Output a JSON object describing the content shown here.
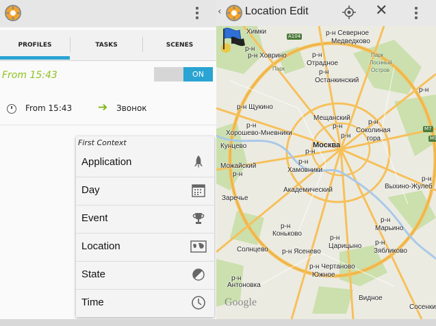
{
  "left_panel": {
    "tabs": [
      {
        "label": "PROFILES"
      },
      {
        "label": "TASKS"
      },
      {
        "label": "SCENES"
      }
    ],
    "profile": {
      "title": "From 15:43",
      "toggle_label": "ON",
      "context_text": "From 15:43",
      "task_text": "Звонок"
    },
    "context_menu": {
      "header": "First Context",
      "items": [
        {
          "label": "Application",
          "icon": "rocket-icon"
        },
        {
          "label": "Day",
          "icon": "calendar-icon"
        },
        {
          "label": "Event",
          "icon": "trophy-icon"
        },
        {
          "label": "Location",
          "icon": "map-icon"
        },
        {
          "label": "State",
          "icon": "half-circle-icon"
        },
        {
          "label": "Time",
          "icon": "clock-icon"
        }
      ]
    }
  },
  "right_panel": {
    "title": "Location Edit",
    "map": {
      "city": "Москва",
      "labels": {
        "khimki": "Химки",
        "a104": "А104",
        "rn_sev_medved_1": "р-н Северное",
        "rn_sev_medved_2": "Медведково",
        "rn1": "р-н",
        "khovrino": "р-н Ховрино",
        "otradnoe_rn": "р-н",
        "otradnoe": "Отрадное",
        "park_losiny_1": "Парк",
        "park_losiny_2": "Лосиный",
        "park_losiny_3": "Остров",
        "park": "Парк",
        "ostankinsky_rn": "р-н",
        "ostankinsky": "Останкинский",
        "rn_right": "р-н",
        "shchukino": "р-н Щукино",
        "rn_left": "р-н",
        "khoroshevo": "Хорошево-Мневники",
        "kuntsevo": "Кунцево",
        "meshchansky": "Мещанский",
        "meshchansky_rn": "р-н",
        "rn_mid": "р-н",
        "sokolinaya_rn": "р-н",
        "sokolinaya_1": "Соколиная",
        "sokolinaya_2": "гора",
        "moskva": "Москва",
        "mozhaysky": "Можайский",
        "khamovniki": "Хамовники",
        "rn_mid2": "р-н",
        "rn_mid3": "р-н",
        "vykhino": "Выхино-Жулеб",
        "rn_vykhino": "р-н",
        "zarechye": "Заречье",
        "akademichesky": "Академический",
        "rn_pech": "р-н",
        "konkovo": "Коньково",
        "konkovo_rn": "р-н",
        "tsaritsyno": "Царицыно",
        "rn_tsar": "р-н",
        "maryino": "Марьино",
        "maryino_rn": "р-н",
        "zyablikovo": "Зябликово",
        "zyablikovo_rn": "р-н",
        "solntsevo": "Солнцево",
        "yasenevo": "р-н Ясенево",
        "chertanovo": "р-н Чертаново",
        "yuzhnoe": "Южное",
        "rn_bottom": "р-н",
        "antonovka": "Антоновка",
        "vidnoe": "Видное",
        "m7": "M7",
        "m9": "M9",
        "sosenki": "Сосенки",
        "google": "Google"
      }
    }
  },
  "colors": {
    "accent": "#2aa4d2",
    "title_green": "#8ec21f",
    "arrow_green": "#7fb514",
    "map_road": "#f6c05a",
    "map_park": "#c8dfa8",
    "map_bg": "#ecebe2"
  }
}
